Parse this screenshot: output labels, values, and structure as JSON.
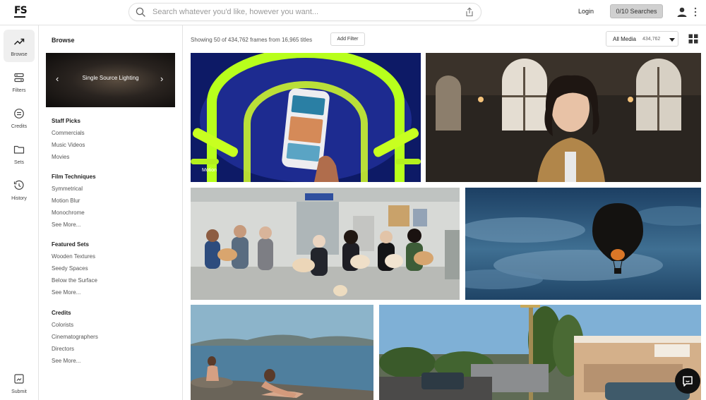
{
  "app": {
    "logo": "FS"
  },
  "search": {
    "placeholder": "Search whatever you'd like, however you want..."
  },
  "header": {
    "login_label": "Login",
    "searches_label": "0/10 Searches"
  },
  "rail": {
    "items": [
      {
        "label": "Browse",
        "icon": "trending-icon"
      },
      {
        "label": "Filters",
        "icon": "filters-icon"
      },
      {
        "label": "Credits",
        "icon": "credits-icon"
      },
      {
        "label": "Sets",
        "icon": "folder-icon"
      },
      {
        "label": "History",
        "icon": "history-icon"
      },
      {
        "label": "Submit",
        "icon": "submit-icon"
      }
    ]
  },
  "browse": {
    "title": "Browse",
    "featured_label": "Single Source Lighting",
    "sections": [
      {
        "title": "Staff Picks",
        "links": [
          "Commercials",
          "Music Videos",
          "Movies"
        ]
      },
      {
        "title": "Film Techniques",
        "links": [
          "Symmetrical",
          "Motion Blur",
          "Monochrome",
          "See More..."
        ]
      },
      {
        "title": "Featured Sets",
        "links": [
          "Wooden Textures",
          "Seedy Spaces",
          "Below the Surface",
          "See More..."
        ]
      },
      {
        "title": "Credits",
        "links": [
          "Colorists",
          "Cinematographers",
          "Directors",
          "See More..."
        ]
      }
    ]
  },
  "results": {
    "showing_text": "Showing 50 of 434,762 frames from 16,965 titles",
    "add_filter_label": "Add Filter",
    "media_label": "All Media",
    "media_count": "434,762",
    "first_frame_tag": "Motion"
  },
  "colors": {
    "accent": "#111111",
    "searches_bg": "#d0d0d0",
    "rail_active": "#efefef"
  }
}
